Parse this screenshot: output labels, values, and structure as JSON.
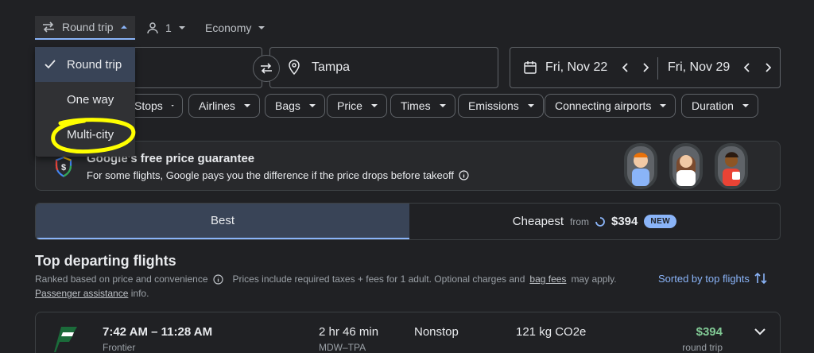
{
  "search": {
    "trip_type": "Round trip",
    "passengers": "1",
    "cabin": "Economy",
    "destination": "Tampa",
    "depart_date": "Fri, Nov 22",
    "return_date": "Fri, Nov 29"
  },
  "trip_menu": {
    "options": [
      "Round trip",
      "One way",
      "Multi-city"
    ],
    "selected": "Round trip"
  },
  "filters": {
    "stops": "Stops",
    "airlines": "Airlines",
    "bags": "Bags",
    "price": "Price",
    "times": "Times",
    "emissions": "Emissions",
    "connecting": "Connecting airports",
    "duration": "Duration"
  },
  "promo": {
    "title_visible": "Google's free price guarantee",
    "title_shown": "s free price guarantee",
    "text": "For some flights, Google pays you the difference if the price drops before takeoff"
  },
  "tabs": {
    "best": "Best",
    "cheapest": "Cheapest",
    "cheapest_from": "from",
    "cheapest_price": "$394",
    "new_badge": "NEW"
  },
  "results": {
    "title": "Top departing flights",
    "ranked_text": "Ranked based on price and convenience",
    "prices_text": "Prices include required taxes + fees for 1 adult. Optional charges and",
    "bag_fees_link": "bag fees",
    "apply_text": "may apply.",
    "assistance_link": "Passenger assistance",
    "info_text": "info.",
    "sort_label": "Sorted by top flights"
  },
  "flights": [
    {
      "times": "7:42 AM – 11:28 AM",
      "airline": "Frontier",
      "duration": "2 hr 46 min",
      "route": "MDW–TPA",
      "stops": "Nonstop",
      "emissions": "121 kg CO2e",
      "price": "$394",
      "price_type": "round trip"
    }
  ],
  "colors": {
    "background": "#202124",
    "accent": "#8ab4f8",
    "price_green": "#81c995",
    "highlight_circle": "#ffff00",
    "frontier_green": "#1b6b3a"
  }
}
